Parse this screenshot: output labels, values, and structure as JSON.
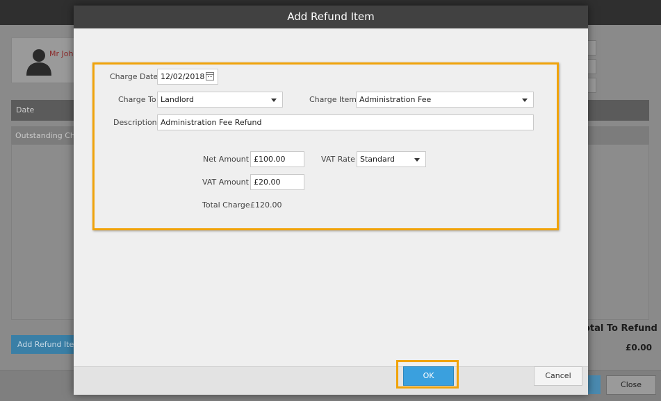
{
  "background": {
    "contact_name": "Mr John",
    "grid_header_date": "Date",
    "grid_subheader": "Outstanding Cha",
    "add_refund_button": "Add Refund Item",
    "total_label": "otal To Refund",
    "total_value": "£0.00",
    "close_button": "Close"
  },
  "dialog": {
    "title": "Add Refund Item",
    "charge_date_label": "Charge Date",
    "charge_date_value": "12/02/2018",
    "charge_to_label": "Charge To",
    "charge_to_value": "Landlord",
    "charge_item_label": "Charge Item",
    "charge_item_value": "Administration Fee",
    "description_label": "Description",
    "description_value": "Administration Fee Refund",
    "net_amount_label": "Net Amount",
    "net_amount_value": "£100.00",
    "vat_rate_label": "VAT Rate",
    "vat_rate_value": "Standard",
    "vat_amount_label": "VAT Amount",
    "vat_amount_value": "£20.00",
    "total_charge_label": "Total Charge",
    "total_charge_value": "£120.00",
    "ok_button": "OK",
    "cancel_button": "Cancel"
  },
  "colors": {
    "accent_highlight": "#f0a30a",
    "ok_button": "#3aa0de",
    "header": "#414141"
  }
}
